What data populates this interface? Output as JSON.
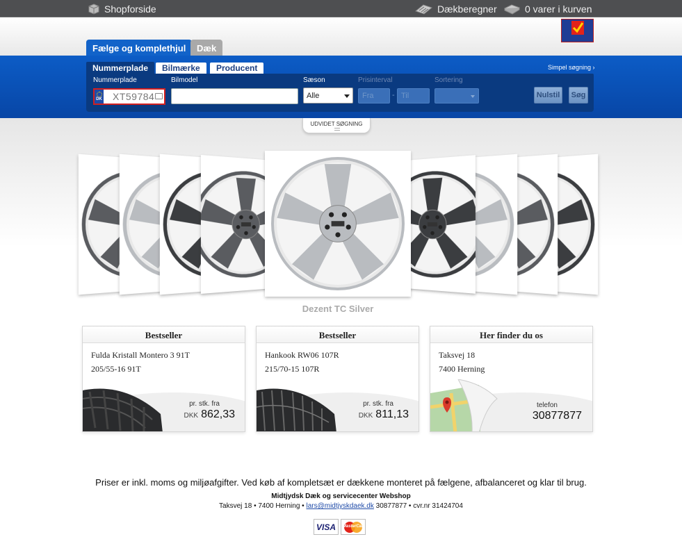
{
  "topbar": {
    "shop": "Shopforside",
    "calculator": "Dækberegner",
    "cart": "0 varer i kurven"
  },
  "tabs": {
    "rims": "Fælge og komplethjul",
    "tires": "Dæk"
  },
  "search": {
    "subtabs": [
      "Nummerplade",
      "Bilmærke",
      "Producent"
    ],
    "simple_search": "Simpel søgning ›",
    "label_plate": "Nummerplade",
    "plate_country": "DK",
    "plate_value": "XT59784",
    "label_model": "Bilmodel",
    "label_season": "Sæson",
    "season_value": "Alle",
    "label_price": "Prisinterval",
    "price_from": "Fra",
    "price_sep": "-",
    "price_to": "Til",
    "label_sort": "Sortering",
    "reset": "Nulstil",
    "search": "Søg",
    "advanced": "UDVIDET SØGNING"
  },
  "carousel": {
    "caption": "Dezent TC Silver",
    "colors": {
      "silver": "#b9bcc0",
      "dark": "#3b3d40",
      "graphite": "#5a5c60"
    }
  },
  "boxes": [
    {
      "title": "Bestseller",
      "line1": "Fulda Kristall Montero 3 91T",
      "line2": "205/55-16 91T",
      "price_label": "pr. stk. fra",
      "currency": "DKK",
      "price": "862,33"
    },
    {
      "title": "Bestseller",
      "line1": "Hankook RW06 107R",
      "line2": "215/70-15 107R",
      "price_label": "pr. stk. fra",
      "currency": "DKK",
      "price": "811,13"
    },
    {
      "title": "Her finder du os",
      "line1": "Taksvej 18",
      "line2": "7400 Herning",
      "price_label": "telefon",
      "currency": "",
      "price": "30877877"
    }
  ],
  "footer": {
    "note": "Priser er inkl. moms og miljøafgifter. Ved køb af kompletsæt er dækkene monteret på fælgene, afbalanceret og klar til brug.",
    "company": "Midtjydsk Dæk og servicecenter Webshop",
    "address": "Taksvej 18 • 7400 Herning •",
    "email": "lars@midtjyskdaek.dk",
    "phone_cvr": "30877877 • cvr.nr 31424704",
    "visa": "VISA",
    "mastercard": "MasterCard"
  },
  "colors": {
    "blue": "#0c5cc6",
    "dark_panel": "#0a3a80",
    "topbar": "#4e4f51"
  }
}
